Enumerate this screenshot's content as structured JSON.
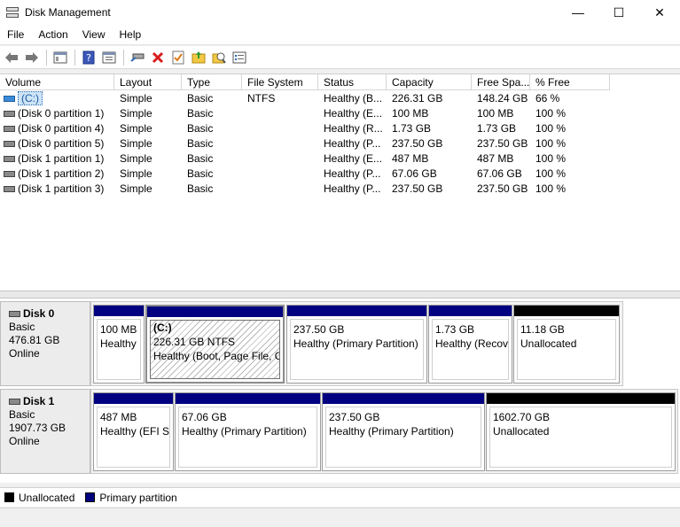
{
  "window": {
    "title": "Disk Management",
    "controls": {
      "minimize": "—",
      "maximize": "☐",
      "close": "✕"
    }
  },
  "menu": [
    "File",
    "Action",
    "View",
    "Help"
  ],
  "toolbar": {
    "icons": [
      "back-icon",
      "forward-icon",
      "show-hide-console-tree-icon",
      "help-icon",
      "properties-icon",
      "connect-icon",
      "delete-icon",
      "check-icon",
      "up-folder-icon",
      "search-icon",
      "list-icon"
    ]
  },
  "volume_list": {
    "columns": [
      "Volume",
      "Layout",
      "Type",
      "File System",
      "Status",
      "Capacity",
      "Free Spa...",
      "% Free"
    ],
    "rows": [
      {
        "volume": "(C:)",
        "layout": "Simple",
        "type": "Basic",
        "fs": "NTFS",
        "status": "Healthy (B...",
        "capacity": "226.31 GB",
        "free": "148.24 GB",
        "pct": "66 %"
      },
      {
        "volume": "(Disk 0 partition 1)",
        "layout": "Simple",
        "type": "Basic",
        "fs": "",
        "status": "Healthy (E...",
        "capacity": "100 MB",
        "free": "100 MB",
        "pct": "100 %"
      },
      {
        "volume": "(Disk 0 partition 4)",
        "layout": "Simple",
        "type": "Basic",
        "fs": "",
        "status": "Healthy (R...",
        "capacity": "1.73 GB",
        "free": "1.73 GB",
        "pct": "100 %"
      },
      {
        "volume": "(Disk 0 partition 5)",
        "layout": "Simple",
        "type": "Basic",
        "fs": "",
        "status": "Healthy (P...",
        "capacity": "237.50 GB",
        "free": "237.50 GB",
        "pct": "100 %"
      },
      {
        "volume": "(Disk 1 partition 1)",
        "layout": "Simple",
        "type": "Basic",
        "fs": "",
        "status": "Healthy (E...",
        "capacity": "487 MB",
        "free": "487 MB",
        "pct": "100 %"
      },
      {
        "volume": "(Disk 1 partition 2)",
        "layout": "Simple",
        "type": "Basic",
        "fs": "",
        "status": "Healthy (P...",
        "capacity": "67.06 GB",
        "free": "67.06 GB",
        "pct": "100 %"
      },
      {
        "volume": "(Disk 1 partition 3)",
        "layout": "Simple",
        "type": "Basic",
        "fs": "",
        "status": "Healthy (P...",
        "capacity": "237.50 GB",
        "free": "237.50 GB",
        "pct": "100 %"
      }
    ]
  },
  "disks": [
    {
      "name": "Disk 0",
      "type": "Basic",
      "size": "476.81 GB",
      "state": "Online",
      "partitions": [
        {
          "title": "",
          "size": "100 MB",
          "status": "Healthy",
          "kind": "primary"
        },
        {
          "title": "(C:)",
          "size": "226.31 GB NTFS",
          "status": "Healthy (Boot, Page File, Cr",
          "kind": "primary",
          "selected": true
        },
        {
          "title": "",
          "size": "237.50 GB",
          "status": "Healthy (Primary Partition)",
          "kind": "primary"
        },
        {
          "title": "",
          "size": "1.73 GB",
          "status": "Healthy (Recov",
          "kind": "primary"
        },
        {
          "title": "",
          "size": "11.18 GB",
          "status": "Unallocated",
          "kind": "unallocated"
        }
      ]
    },
    {
      "name": "Disk 1",
      "type": "Basic",
      "size": "1907.73 GB",
      "state": "Online",
      "partitions": [
        {
          "title": "",
          "size": "487 MB",
          "status": "Healthy (EFI Sy",
          "kind": "primary"
        },
        {
          "title": "",
          "size": "67.06 GB",
          "status": "Healthy (Primary Partition)",
          "kind": "primary"
        },
        {
          "title": "",
          "size": "237.50 GB",
          "status": "Healthy (Primary Partition)",
          "kind": "primary"
        },
        {
          "title": "",
          "size": "1602.70 GB",
          "status": "Unallocated",
          "kind": "unallocated"
        }
      ]
    }
  ],
  "legend": [
    {
      "label": "Unallocated",
      "color": "#000000"
    },
    {
      "label": "Primary partition",
      "color": "#000080"
    }
  ],
  "colors": {
    "primary": "#000080",
    "unallocated": "#000000"
  }
}
